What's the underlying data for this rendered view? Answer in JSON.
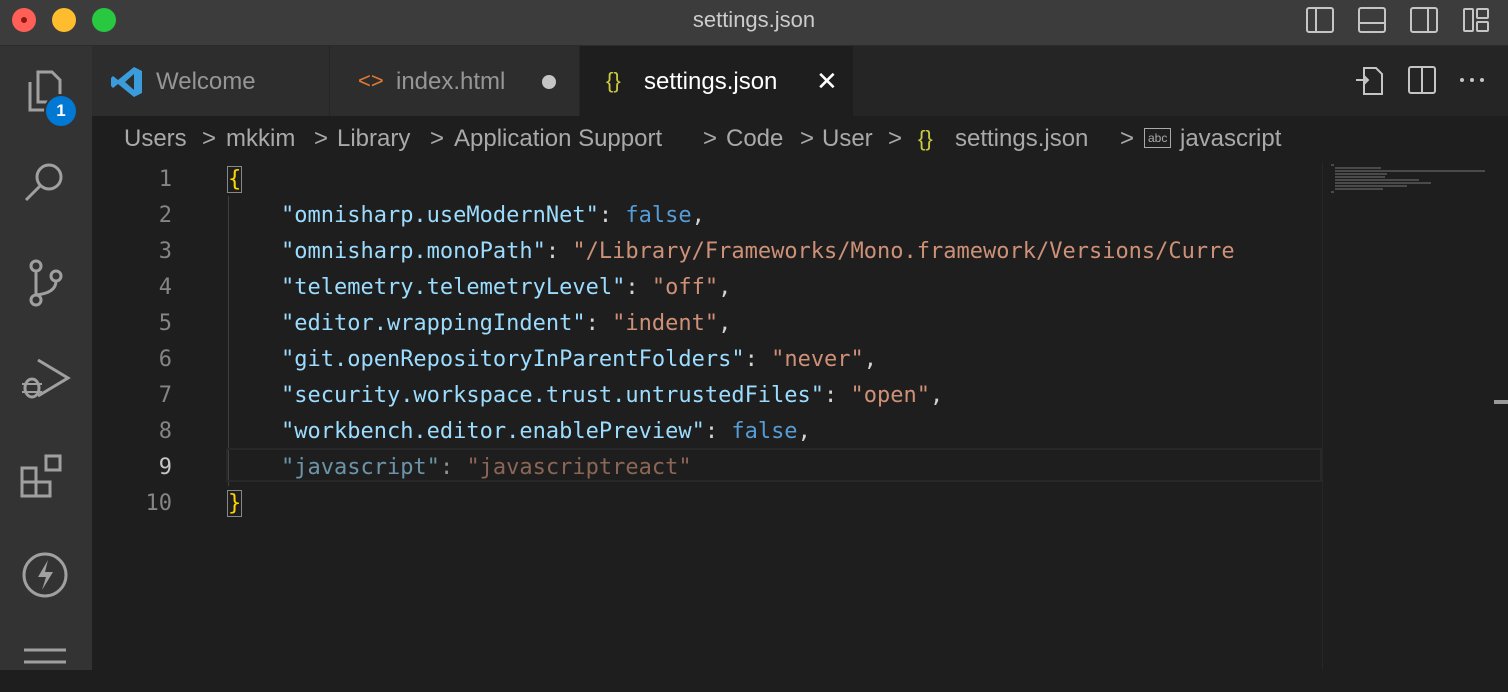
{
  "window": {
    "title": "settings.json"
  },
  "activity_bar": {
    "items": [
      "files-icon",
      "search-icon",
      "source-control-icon",
      "run-debug-icon",
      "extensions-icon",
      "lightning-icon",
      "menu-icon"
    ],
    "explorer_badge": "1"
  },
  "tabs": [
    {
      "label": "Welcome",
      "icon": "vscode-logo-icon",
      "active": false
    },
    {
      "label": "index.html",
      "icon": "<>",
      "active": false,
      "dirty": true
    },
    {
      "label": "settings.json",
      "icon": "{}",
      "active": true,
      "close": "✕"
    }
  ],
  "breadcrumb": {
    "items": [
      "Users",
      "mkkim",
      "Library",
      "Application Support",
      "Code",
      "User",
      "settings.json",
      "javascript"
    ],
    "json_icon": "{}",
    "abc_icon": "abc",
    "separator": ">"
  },
  "editor": {
    "line_numbers": [
      "1",
      "2",
      "3",
      "4",
      "5",
      "6",
      "7",
      "8",
      "9",
      "10"
    ],
    "current_line": "9",
    "lines": {
      "l1": {
        "brace": "{"
      },
      "l2": {
        "key": "\"omnisharp.useModernNet\"",
        "colon": ": ",
        "value": "false",
        "comma": ","
      },
      "l3": {
        "key": "\"omnisharp.monoPath\"",
        "colon": ": ",
        "value": "\"/Library/Frameworks/Mono.framework/Versions/Curre"
      },
      "l4": {
        "key": "\"telemetry.telemetryLevel\"",
        "colon": ": ",
        "value": "\"off\"",
        "comma": ","
      },
      "l5": {
        "key": "\"editor.wrappingIndent\"",
        "colon": ": ",
        "value": "\"indent\"",
        "comma": ","
      },
      "l6": {
        "key": "\"git.openRepositoryInParentFolders\"",
        "colon": ": ",
        "value": "\"never\"",
        "comma": ","
      },
      "l7": {
        "key": "\"security.workspace.trust.untrustedFiles\"",
        "colon": ": ",
        "value": "\"open\"",
        "comma": ","
      },
      "l8": {
        "key": "\"workbench.editor.enablePreview\"",
        "colon": ": ",
        "value": "false",
        "comma": ","
      },
      "l9": {
        "key": "\"javascript\"",
        "colon": ": ",
        "value": "\"javascriptreact\""
      },
      "l10": {
        "brace": "}"
      }
    }
  },
  "colors": {
    "key": "#9cdcfe",
    "string": "#ce9178",
    "boolean": "#569cd6",
    "brace": "#ffd700",
    "badge": "#0078d4"
  }
}
